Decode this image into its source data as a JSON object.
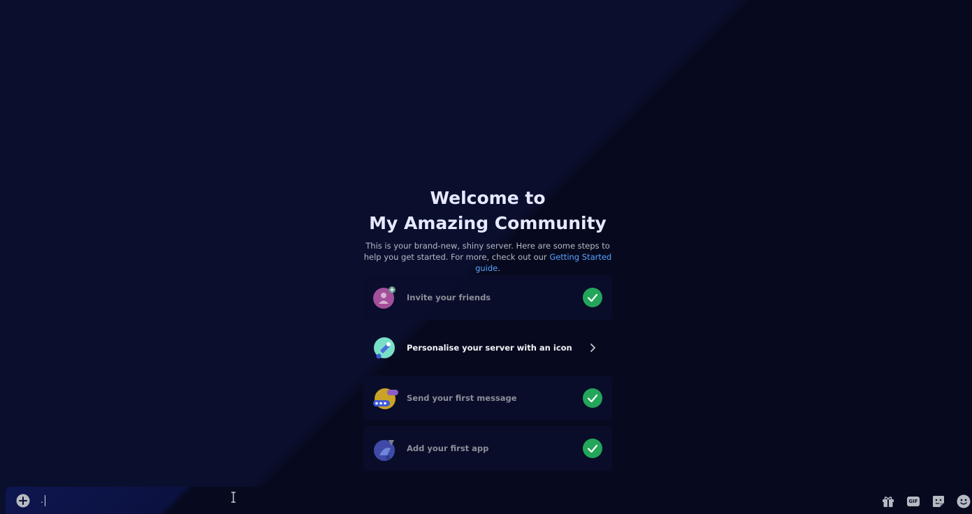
{
  "welcome": {
    "title_line1": "Welcome to",
    "title_line2": "My Amazing Community",
    "description": "This is your brand-new, shiny server. Here are some steps to help you get started. For more, check out our ",
    "guide_link": "Getting Started guide",
    "description_end": "."
  },
  "steps": [
    {
      "label": "Invite your friends",
      "status": "completed",
      "icon": "invite-friends-icon"
    },
    {
      "label": "Personalise your server with an icon",
      "status": "pending",
      "icon": "server-icon-icon"
    },
    {
      "label": "Send your first message",
      "status": "completed",
      "icon": "message-icon"
    },
    {
      "label": "Add your first app",
      "status": "completed",
      "icon": "app-icon"
    }
  ],
  "composer": {
    "input_value": ".",
    "gif_label": "GIF"
  },
  "colors": {
    "success": "#23a55a",
    "link": "#5aa2ff",
    "background": "#0b0f2e"
  }
}
